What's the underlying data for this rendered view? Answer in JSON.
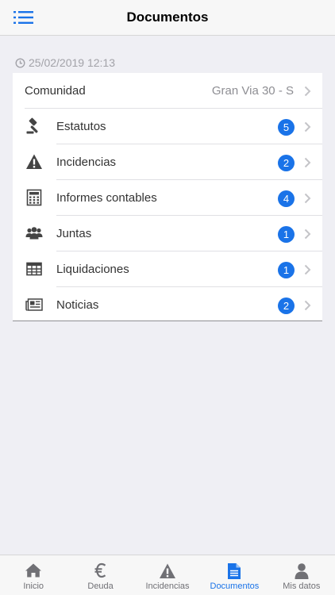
{
  "header": {
    "title": "Documentos"
  },
  "timestamp": "25/02/2019 12:13",
  "community": {
    "label": "Comunidad",
    "value": "Gran Via 30 - S"
  },
  "items": [
    {
      "label": "Estatutos",
      "count": "5",
      "icon": "gavel-icon"
    },
    {
      "label": "Incidencias",
      "count": "2",
      "icon": "warning-icon"
    },
    {
      "label": "Informes contables",
      "count": "4",
      "icon": "calculator-icon"
    },
    {
      "label": "Juntas",
      "count": "1",
      "icon": "users-icon"
    },
    {
      "label": "Liquidaciones",
      "count": "1",
      "icon": "table-icon"
    },
    {
      "label": "Noticias",
      "count": "2",
      "icon": "newspaper-icon"
    }
  ],
  "tabs": [
    {
      "label": "Inicio",
      "icon": "home-icon"
    },
    {
      "label": "Deuda",
      "icon": "euro-icon"
    },
    {
      "label": "Incidencias",
      "icon": "warning-icon"
    },
    {
      "label": "Documentos",
      "icon": "document-icon",
      "active": true
    },
    {
      "label": "Mis datos",
      "icon": "user-icon"
    }
  ],
  "colors": {
    "accent": "#1a73e8",
    "background": "#efeff4"
  }
}
